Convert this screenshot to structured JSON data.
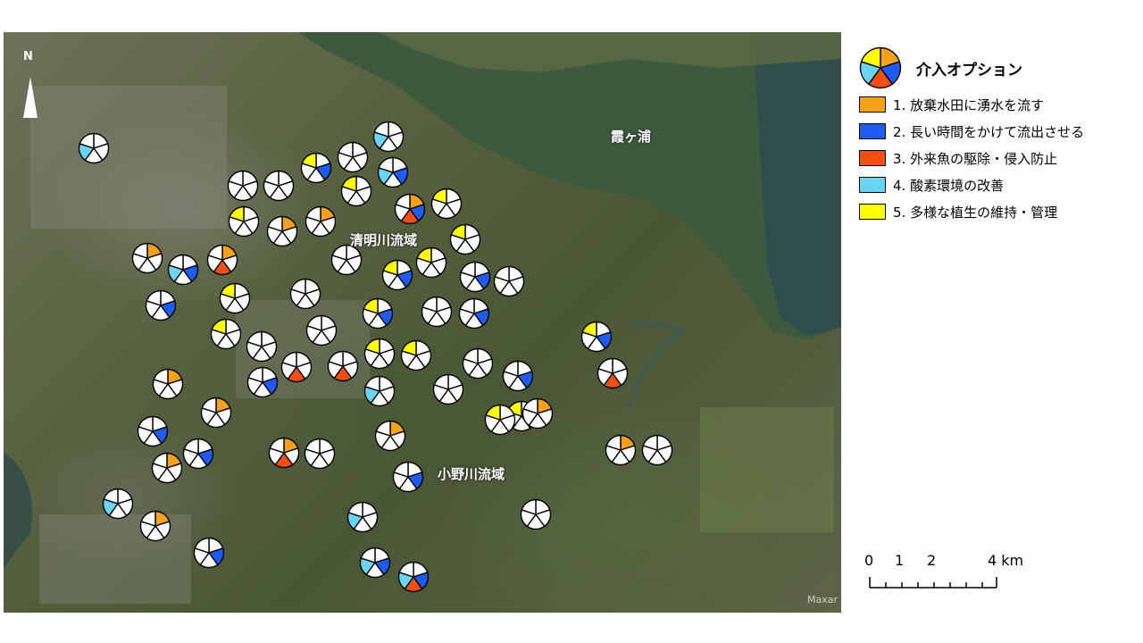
{
  "map": {
    "north_label": "N",
    "place_labels": {
      "lake": "霞ヶ浦",
      "basin_north": "清明川流域",
      "basin_south": "小野川流域"
    },
    "attribution": "Maxar",
    "colors": {
      "lake": "#3d5a3f",
      "lake_deep": "#27425a",
      "pie_outline": "#000000",
      "pie_empty": "#ffffff"
    }
  },
  "legend": {
    "title": "介入オプション",
    "items": [
      {
        "id": 1,
        "label": "1. 放棄水田に湧水を流す",
        "color": "#f7a11a"
      },
      {
        "id": 2,
        "label": "2. 長い時間をかけて流出させる",
        "color": "#1e5bf0"
      },
      {
        "id": 3,
        "label": "3. 外来魚の駆除・侵入防止",
        "color": "#f04e12"
      },
      {
        "id": 4,
        "label": "4. 酸素環境の改善",
        "color": "#6ad5f2"
      },
      {
        "id": 5,
        "label": "5. 多様な植生の維持・管理",
        "color": "#ffff00"
      }
    ]
  },
  "scale_bar": {
    "labels": [
      "0",
      "1",
      "2",
      "4 km"
    ],
    "unit": "km"
  },
  "sites": [
    {
      "name": "site-01",
      "options": [
        4
      ]
    },
    {
      "name": "site-02",
      "options": [
        4
      ]
    },
    {
      "name": "site-03",
      "options": []
    },
    {
      "name": "site-04",
      "options": [
        5,
        2
      ]
    },
    {
      "name": "site-05",
      "options": [
        2,
        4
      ]
    },
    {
      "name": "site-06",
      "options": []
    },
    {
      "name": "site-07",
      "options": []
    },
    {
      "name": "site-08",
      "options": [
        5
      ]
    },
    {
      "name": "site-09",
      "options": [
        1,
        2,
        3
      ]
    },
    {
      "name": "site-10",
      "options": [
        5
      ]
    },
    {
      "name": "site-11",
      "options": [
        5
      ]
    },
    {
      "name": "site-12",
      "options": [
        1
      ]
    },
    {
      "name": "site-13",
      "options": [
        1
      ]
    },
    {
      "name": "site-14",
      "options": [
        5
      ]
    },
    {
      "name": "site-15",
      "options": [
        1
      ]
    },
    {
      "name": "site-16",
      "options": []
    },
    {
      "name": "site-17",
      "options": [
        4,
        2
      ]
    },
    {
      "name": "site-18",
      "options": [
        1,
        3
      ]
    },
    {
      "name": "site-19",
      "options": [
        5
      ]
    },
    {
      "name": "site-20",
      "options": [
        5,
        2
      ]
    },
    {
      "name": "site-21",
      "options": [
        2
      ]
    },
    {
      "name": "site-22",
      "options": []
    },
    {
      "name": "site-23",
      "options": [
        2
      ]
    },
    {
      "name": "site-24",
      "options": [
        5
      ]
    },
    {
      "name": "site-25",
      "options": []
    },
    {
      "name": "site-26",
      "options": [
        5,
        2
      ]
    },
    {
      "name": "site-27",
      "options": []
    },
    {
      "name": "site-28",
      "options": [
        2
      ]
    },
    {
      "name": "site-29",
      "options": [
        5
      ]
    },
    {
      "name": "site-30",
      "options": []
    },
    {
      "name": "site-31",
      "options": []
    },
    {
      "name": "site-32",
      "options": [
        5,
        2
      ]
    },
    {
      "name": "site-33",
      "options": [
        3
      ]
    },
    {
      "name": "site-34",
      "options": [
        5
      ]
    },
    {
      "name": "site-35",
      "options": [
        5
      ]
    },
    {
      "name": "site-36",
      "options": []
    },
    {
      "name": "site-37",
      "options": [
        2
      ]
    },
    {
      "name": "site-38",
      "options": [
        3
      ]
    },
    {
      "name": "site-39",
      "options": [
        2
      ]
    },
    {
      "name": "site-40",
      "options": [
        4
      ]
    },
    {
      "name": "site-41",
      "options": [
        1
      ]
    },
    {
      "name": "site-42",
      "options": []
    },
    {
      "name": "site-43",
      "options": [
        5,
        2
      ]
    },
    {
      "name": "site-44",
      "options": [
        1
      ]
    },
    {
      "name": "site-45",
      "options": [
        3
      ]
    },
    {
      "name": "site-46",
      "options": [
        2
      ]
    },
    {
      "name": "site-47",
      "options": [
        5
      ]
    },
    {
      "name": "site-48",
      "options": [
        1
      ]
    },
    {
      "name": "site-49",
      "options": [
        1,
        3
      ]
    },
    {
      "name": "site-50",
      "options": []
    },
    {
      "name": "site-51",
      "options": [
        1
      ]
    },
    {
      "name": "site-52",
      "options": [
        4
      ]
    },
    {
      "name": "site-53",
      "options": [
        1
      ]
    },
    {
      "name": "site-54",
      "options": []
    },
    {
      "name": "site-55",
      "options": [
        4
      ]
    },
    {
      "name": "site-56",
      "options": [
        2
      ]
    },
    {
      "name": "site-57",
      "options": [
        2
      ]
    },
    {
      "name": "site-58",
      "options": [
        4,
        2
      ]
    },
    {
      "name": "site-59",
      "options": [
        2
      ]
    },
    {
      "name": "site-60",
      "options": [
        4,
        2,
        3
      ]
    },
    {
      "name": "site-61",
      "options": [
        1
      ]
    },
    {
      "name": "site-62",
      "options": []
    },
    {
      "name": "site-63",
      "options": [
        1
      ]
    },
    {
      "name": "site-64",
      "options": []
    },
    {
      "name": "site-65",
      "options": [
        2
      ]
    }
  ]
}
